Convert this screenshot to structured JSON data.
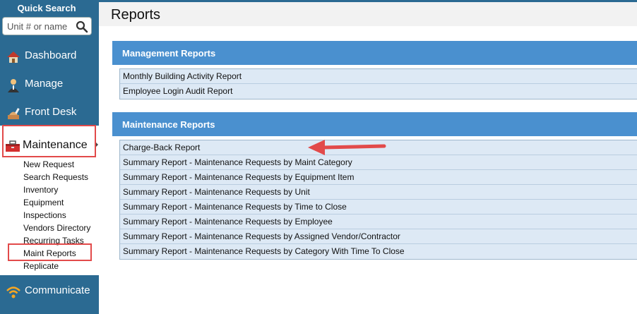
{
  "sidebar": {
    "quick_search_title": "Quick Search",
    "search_placeholder": "Unit # or name",
    "nav": {
      "dashboard": "Dashboard",
      "manage": "Manage",
      "front_desk": "Front Desk",
      "maintenance": "Maintenance",
      "communicate": "Communicate"
    },
    "maintenance_items": [
      "New Request",
      "Search Requests",
      "Inventory",
      "Equipment",
      "Inspections",
      "Vendors Directory",
      "Recurring Tasks",
      "Maint Reports",
      "Replicate"
    ]
  },
  "main": {
    "title": "Reports",
    "management": {
      "header": "Management Reports",
      "reports": [
        "Monthly Building Activity Report",
        "Employee Login Audit Report"
      ]
    },
    "maintenance": {
      "header": "Maintenance Reports",
      "reports": [
        "Charge-Back Report",
        "Summary Report - Maintenance Requests by Maint Category",
        "Summary Report - Maintenance Requests by Equipment Item",
        "Summary Report - Maintenance Requests by Unit",
        "Summary Report - Maintenance Requests by Time to Close",
        "Summary Report - Maintenance Requests by Employee",
        "Summary Report - Maintenance Requests by Assigned Vendor/Contractor",
        "Summary Report - Maintenance Requests by Category With Time To Close"
      ]
    }
  },
  "colors": {
    "sidebar": "#2b6a92",
    "section_header": "#4a90cf",
    "row_bg": "#dde9f5",
    "highlight": "#e24a4a"
  }
}
